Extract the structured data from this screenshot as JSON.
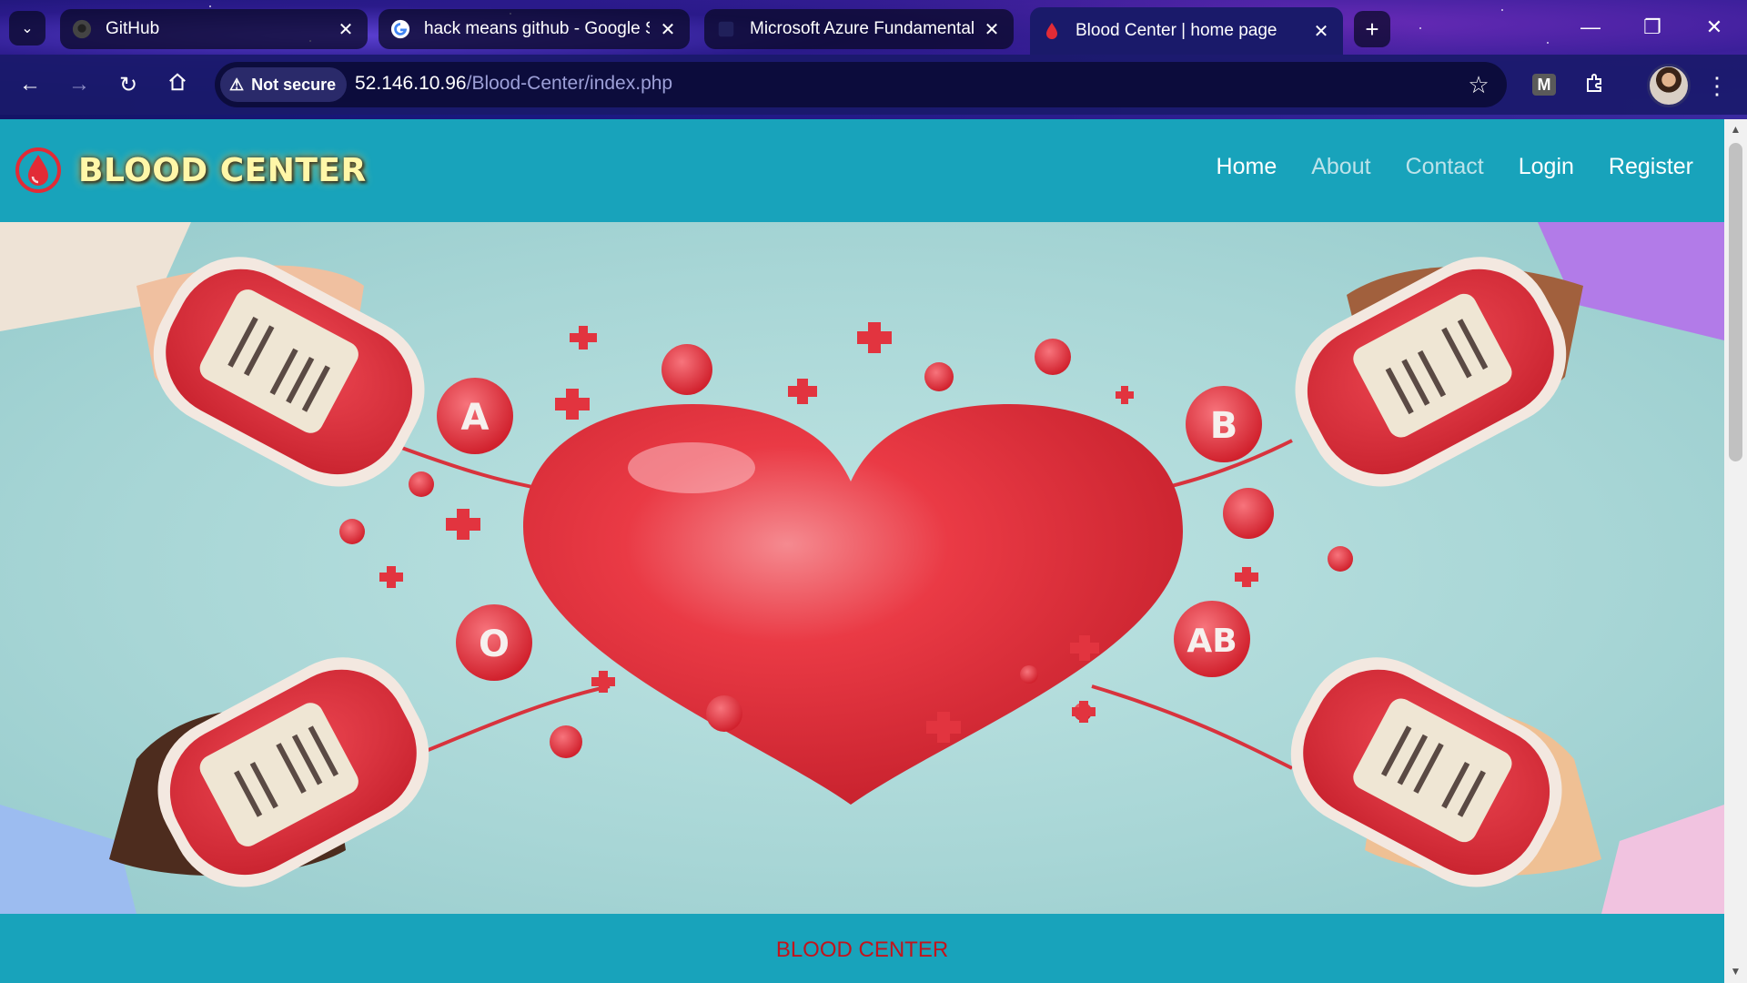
{
  "browser": {
    "tabs": [
      {
        "title": "GitHub",
        "favicon": "github-icon"
      },
      {
        "title": "hack means github - Google S",
        "favicon": "google-icon"
      },
      {
        "title": "Microsoft Azure Fundamentals",
        "favicon": "azure-icon"
      },
      {
        "title": "Blood Center | home page",
        "favicon": "blood-drop-icon",
        "active": true
      }
    ],
    "security_label": "Not secure",
    "url_host": "52.146.10.96",
    "url_path": "/Blood-Center/index.php",
    "extension_label": "M"
  },
  "site": {
    "brand": "BLOOD CENTER",
    "nav": [
      {
        "label": "Home"
      },
      {
        "label": "About"
      },
      {
        "label": "Contact"
      },
      {
        "label": "Login"
      },
      {
        "label": "Register"
      }
    ],
    "hero": {
      "blood_types": [
        "A",
        "B",
        "O",
        "AB"
      ]
    },
    "footer": "BLOOD CENTER"
  },
  "colors": {
    "nav_bg": "#18a3bb",
    "brand_text": "#fff7a8",
    "footer_text": "#c2141c",
    "heart": "#e8333f",
    "hero_bg": "#a8d6d6"
  }
}
